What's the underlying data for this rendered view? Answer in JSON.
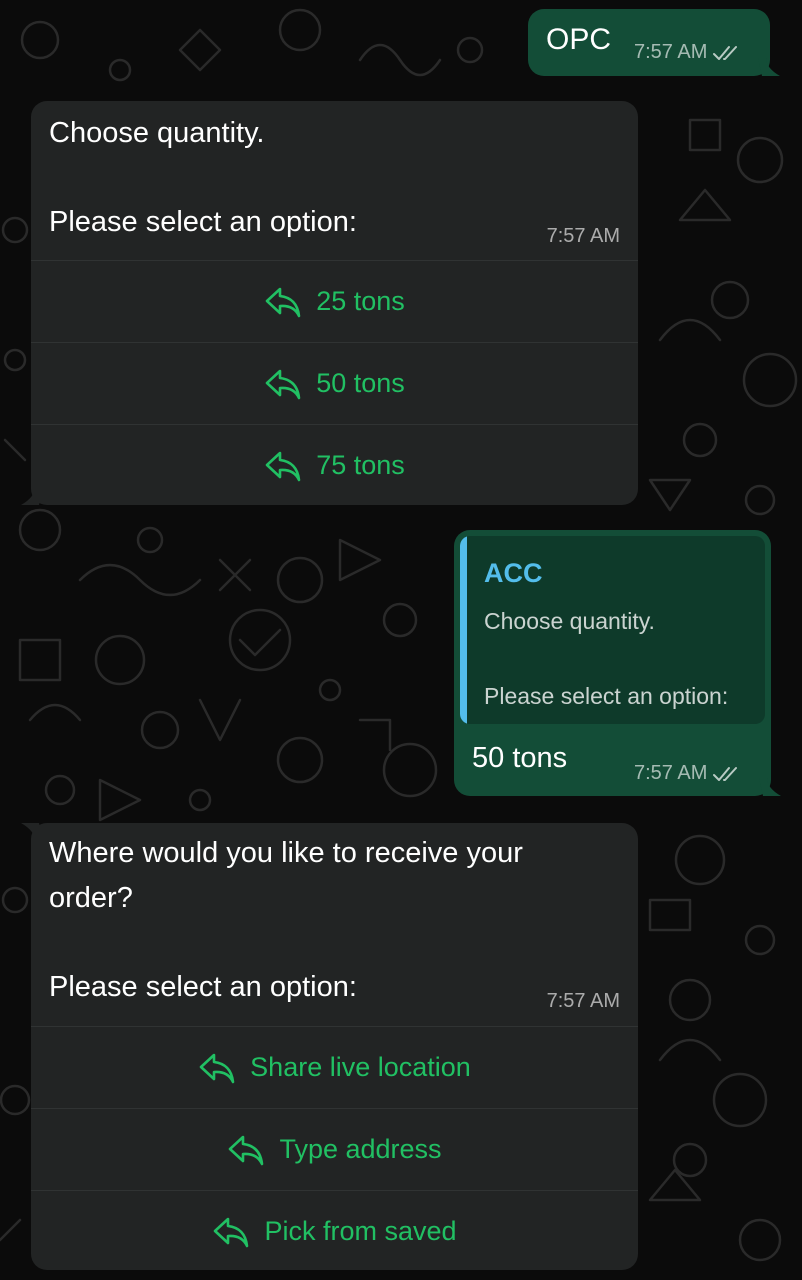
{
  "theme": {
    "outgoing_bubble": "#134d37",
    "incoming_bubble": "#222424",
    "option_color": "#21c063",
    "quote_accent": "#53bdeb",
    "background": "#0b0b0b"
  },
  "messages": {
    "m1": {
      "direction": "outgoing",
      "text": "OPC",
      "time": "7:57 AM",
      "status": "read-double-tick-icon"
    },
    "m2": {
      "direction": "incoming",
      "line1": "Choose quantity.",
      "line2": "Please select an option:",
      "time": "7:57 AM",
      "options": [
        {
          "label": "25 tons",
          "icon": "reply-icon"
        },
        {
          "label": "50 tons",
          "icon": "reply-icon"
        },
        {
          "label": "75 tons",
          "icon": "reply-icon"
        }
      ]
    },
    "m3": {
      "direction": "outgoing",
      "quote": {
        "title": "ACC",
        "line1": "Choose quantity.",
        "line2": "Please select an option:"
      },
      "text": "50 tons",
      "time": "7:57 AM",
      "status": "read-double-tick-icon"
    },
    "m4": {
      "direction": "incoming",
      "line1": "Where would you like to receive your",
      "line2": "order?",
      "line3": "Please select an option:",
      "time": "7:57 AM",
      "options": [
        {
          "label": "Share live location",
          "icon": "reply-icon"
        },
        {
          "label": "Type address",
          "icon": "reply-icon"
        },
        {
          "label": "Pick from saved",
          "icon": "reply-icon"
        }
      ]
    }
  }
}
